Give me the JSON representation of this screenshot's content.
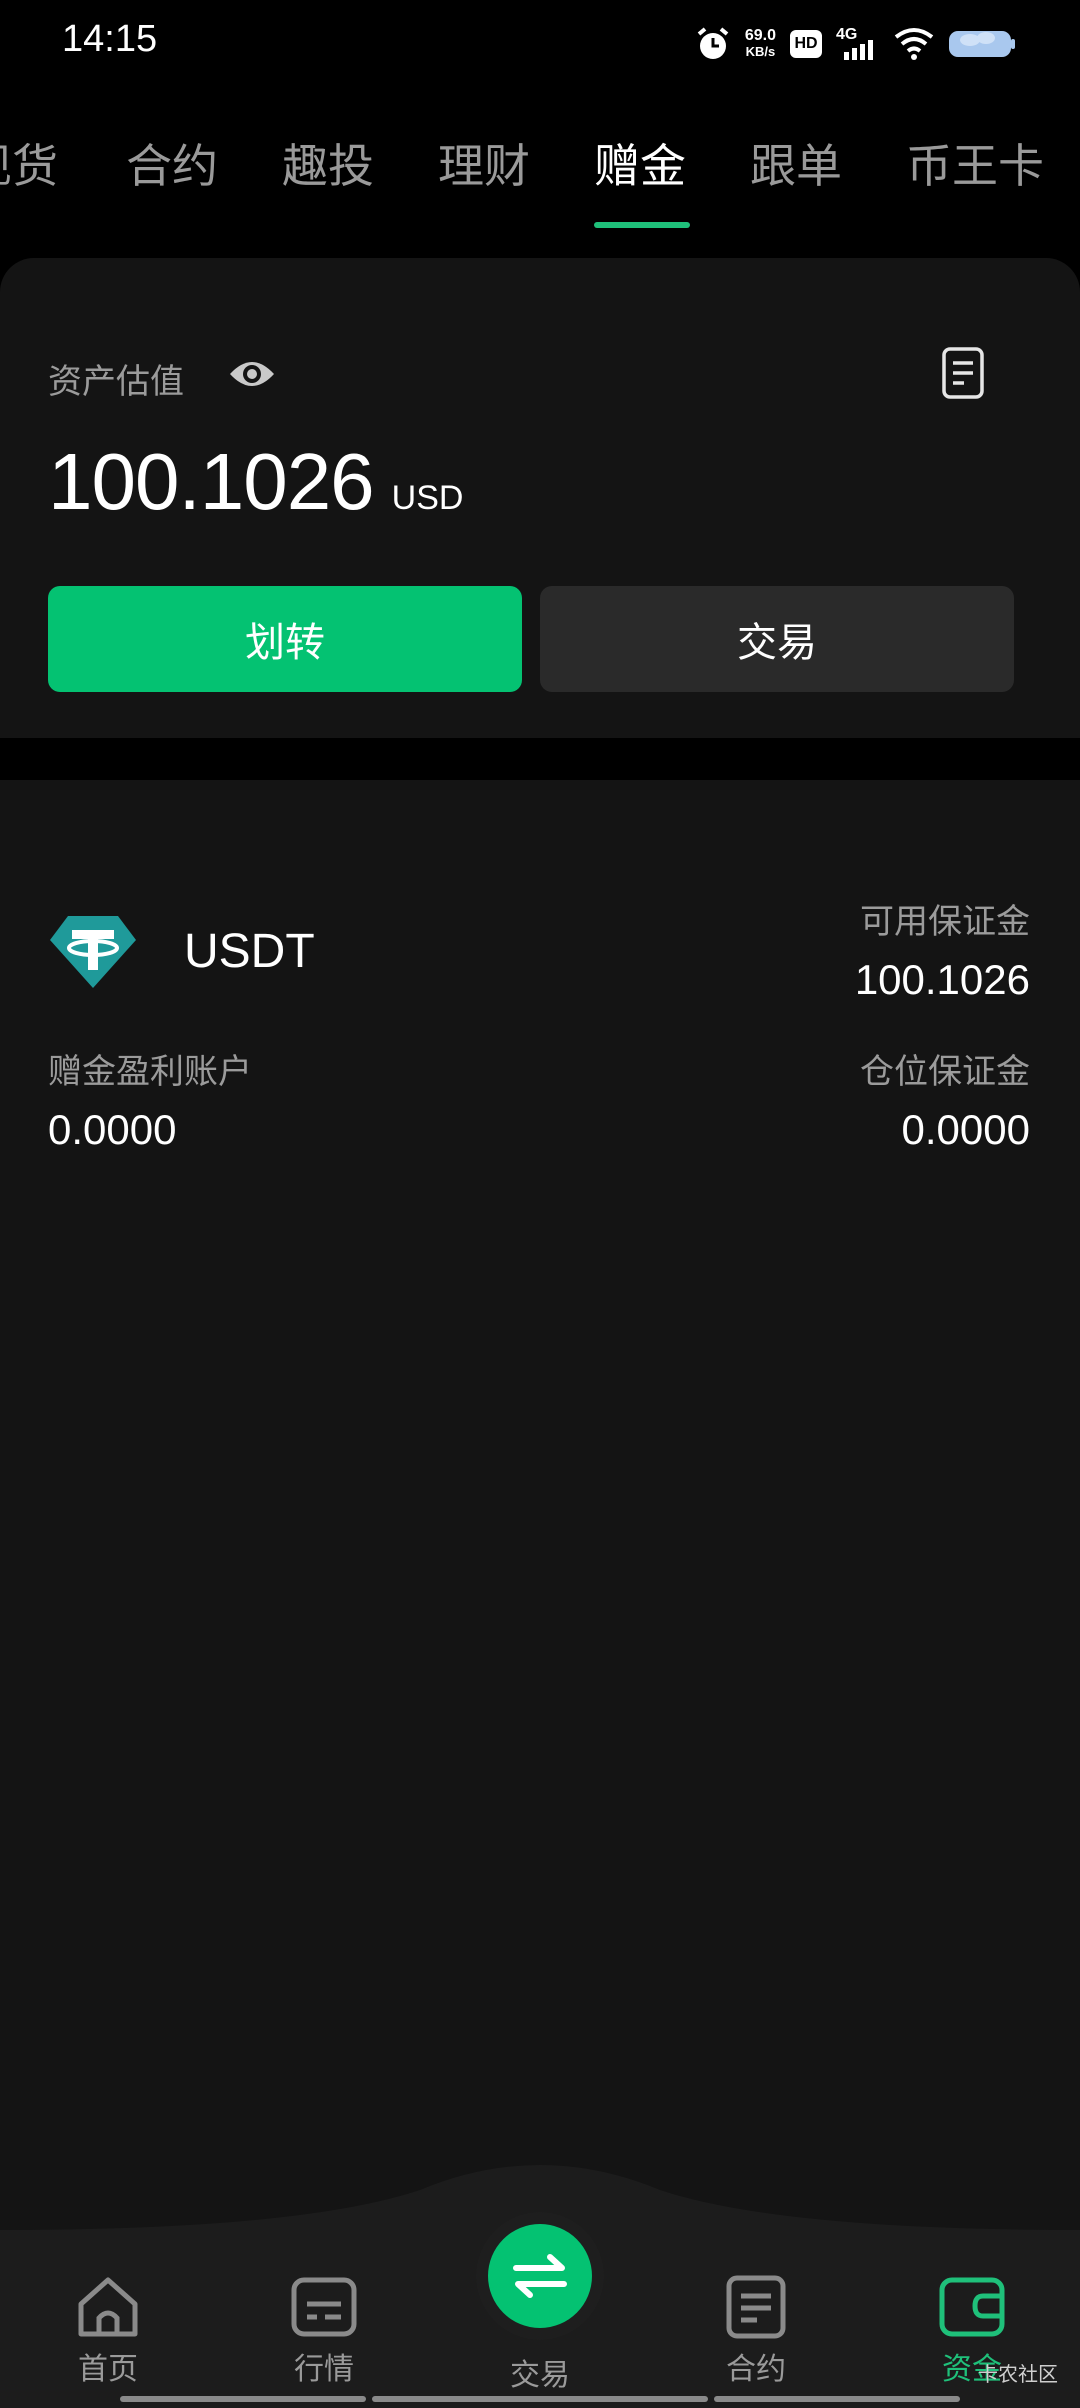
{
  "status_bar": {
    "time": "14:15",
    "net_speed_value": "69.0",
    "net_speed_unit": "KB/s",
    "hd": "HD",
    "network": "4G"
  },
  "tabs": [
    {
      "label": "现货",
      "active": false
    },
    {
      "label": "合约",
      "active": false
    },
    {
      "label": "趣投",
      "active": false
    },
    {
      "label": "理财",
      "active": false
    },
    {
      "label": "赠金",
      "active": true
    },
    {
      "label": "跟单",
      "active": false
    },
    {
      "label": "币王卡",
      "active": false
    }
  ],
  "asset": {
    "label": "资产估值",
    "value": "100.1026",
    "unit": "USD",
    "transfer_label": "划转",
    "trade_label": "交易"
  },
  "account": {
    "coin": "USDT",
    "available_margin_label": "可用保证金",
    "available_margin_value": "100.1026",
    "bonus_profit_label": "赠金盈利账户",
    "bonus_profit_value": "0.0000",
    "position_margin_label": "仓位保证金",
    "position_margin_value": "0.0000"
  },
  "bottom_nav": [
    {
      "label": "首页",
      "icon": "home-icon",
      "active": false
    },
    {
      "label": "行情",
      "icon": "market-icon",
      "active": false
    },
    {
      "label": "交易",
      "icon": "trade-swap-icon",
      "active": false
    },
    {
      "label": "合约",
      "icon": "contract-icon",
      "active": false
    },
    {
      "label": "资金",
      "icon": "wallet-icon",
      "active": true
    }
  ],
  "watermark": "卡农社区",
  "colors": {
    "accent": "#04c272",
    "background": "#000000",
    "card": "#141414",
    "muted_text": "#9b9b9b"
  }
}
